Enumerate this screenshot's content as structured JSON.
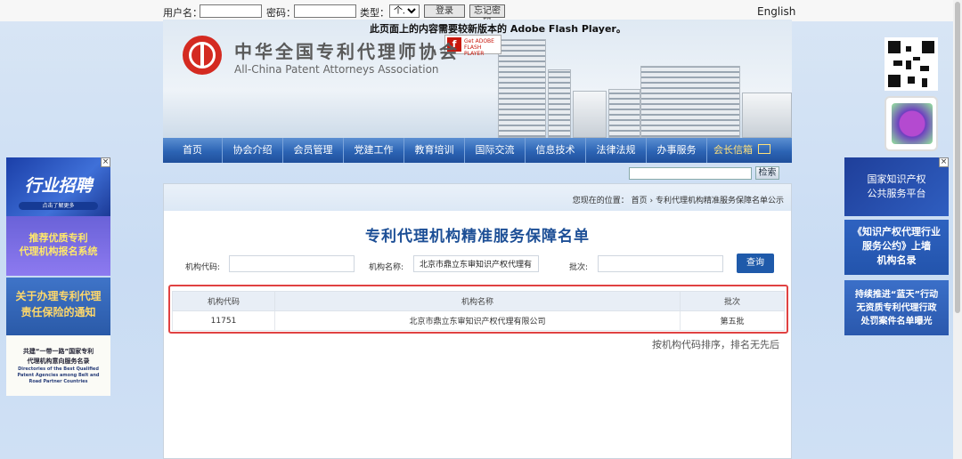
{
  "login_bar": {
    "username_label": "用户名：",
    "password_label": "密码：",
    "type_label": "类型：",
    "type_selected": "个人",
    "login_button": "登录",
    "forgot_button": "忘记密码",
    "english_link": "English"
  },
  "header": {
    "flash_notice": "此页面上的内容需要较新版本的 Adobe Flash Player。",
    "flash_badge": "Get ADOBE FLASH PLAYER",
    "org_name_cn": "中华全国专利代理师协会",
    "org_name_en": "All-China Patent Attorneys Association"
  },
  "nav": {
    "items": [
      "首页",
      "协会介绍",
      "会员管理",
      "党建工作",
      "教育培训",
      "国际交流",
      "信息技术",
      "法律法规",
      "办事服务",
      "会长信箱"
    ]
  },
  "site_search": {
    "value": "",
    "button": "检索"
  },
  "breadcrumb": {
    "prefix": "您现在的位置：",
    "home": "首页",
    "separator": "›",
    "current": "专利代理机构精准服务保障名单公示"
  },
  "page_title": "专利代理机构精准服务保障名单",
  "filters": {
    "code_label": "机构代码:",
    "code_value": "",
    "name_label": "机构名称:",
    "name_value": "北京市鼎立东审知识产权代理有",
    "batch_label": "批次:",
    "batch_value": "",
    "query_button": "查询"
  },
  "results": {
    "headers": [
      "机构代码",
      "机构名称",
      "批次"
    ],
    "rows": [
      [
        "11751",
        "北京市鼎立东审知识产权代理有限公司",
        "第五批"
      ]
    ],
    "sort_note": "按机构代码排序，排名无先后"
  },
  "left_ads": {
    "ad1_title": "行业招聘",
    "ad1_sub": "点击了解更多",
    "ad2_line1": "推荐优质专利",
    "ad2_line2": "代理机构报名系统",
    "ad3_line1": "关于办理专利代理",
    "ad3_line2": "责任保险的通知",
    "ad4_line1": "共建“一带一路”国家专利",
    "ad4_line2": "代理机构意向服务名录",
    "ad4_en1": "Directories of the Best Qualified",
    "ad4_en2": "Patent Agencies among Belt and",
    "ad4_en3": "Road Partner Countries",
    "close": "×"
  },
  "right_ads": {
    "ad1_line1": "国家知识产权",
    "ad1_line2": "公共服务平台",
    "ad2_line1": "《知识产权代理行业",
    "ad2_line2": "服务公约》上墙",
    "ad2_line3": "机构名录",
    "ad3_line1": "持续推进“蓝天”行动",
    "ad3_line2": "无资质专利代理行政",
    "ad3_line3": "处罚案件名单曝光",
    "close": "×"
  }
}
